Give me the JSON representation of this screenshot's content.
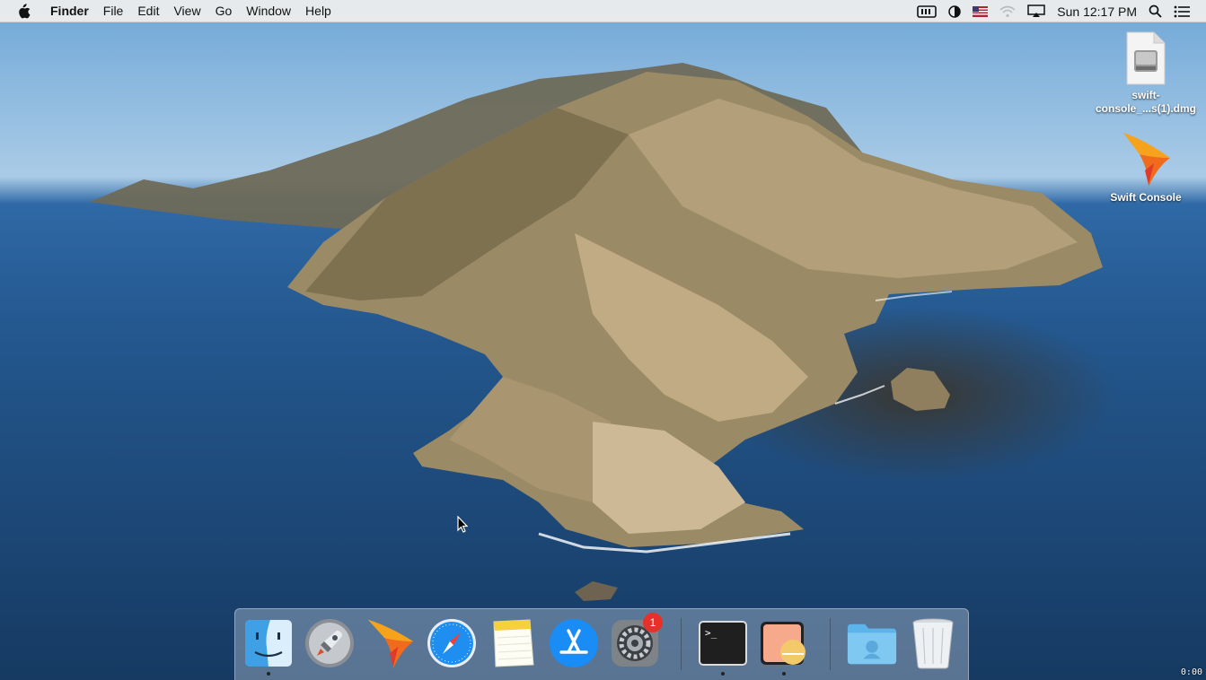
{
  "menubar": {
    "apple_icon": "apple-logo-icon",
    "app_name": "Finder",
    "items": [
      "File",
      "Edit",
      "View",
      "Go",
      "Window",
      "Help"
    ],
    "status": {
      "icons": [
        "input-method-icon",
        "display-contrast-icon",
        "us-flag-icon",
        "wifi-icon",
        "airplay-icon"
      ],
      "clock": "Sun 12:17 PM",
      "right_icons": [
        "spotlight-search-icon",
        "notification-center-icon"
      ]
    }
  },
  "desktop": {
    "icons": [
      {
        "label": "swift-console_...s(1).dmg",
        "icon": "disk-image-icon"
      },
      {
        "label": "Swift Console",
        "icon": "swift-console-app-icon"
      }
    ]
  },
  "dock": {
    "apps": [
      {
        "name": "Finder",
        "icon": "finder-icon",
        "running": true
      },
      {
        "name": "Launchpad",
        "icon": "launchpad-icon",
        "running": false
      },
      {
        "name": "Swift Console",
        "icon": "swift-console-icon",
        "running": false
      },
      {
        "name": "Safari",
        "icon": "safari-icon",
        "running": false
      },
      {
        "name": "Notes",
        "icon": "notes-icon",
        "running": false
      },
      {
        "name": "App Store",
        "icon": "app-store-icon",
        "running": false
      },
      {
        "name": "System Preferences",
        "icon": "system-preferences-icon",
        "running": false,
        "badge": "1"
      },
      {
        "name": "Terminal",
        "icon": "terminal-icon",
        "running": true
      },
      {
        "name": "Preview",
        "icon": "preview-icon",
        "running": true
      },
      {
        "name": "Downloads",
        "icon": "downloads-folder-icon",
        "running": false
      },
      {
        "name": "Trash",
        "icon": "trash-icon",
        "running": false
      }
    ],
    "terminal_prompt": ">_"
  },
  "corner_mark": "0:00"
}
